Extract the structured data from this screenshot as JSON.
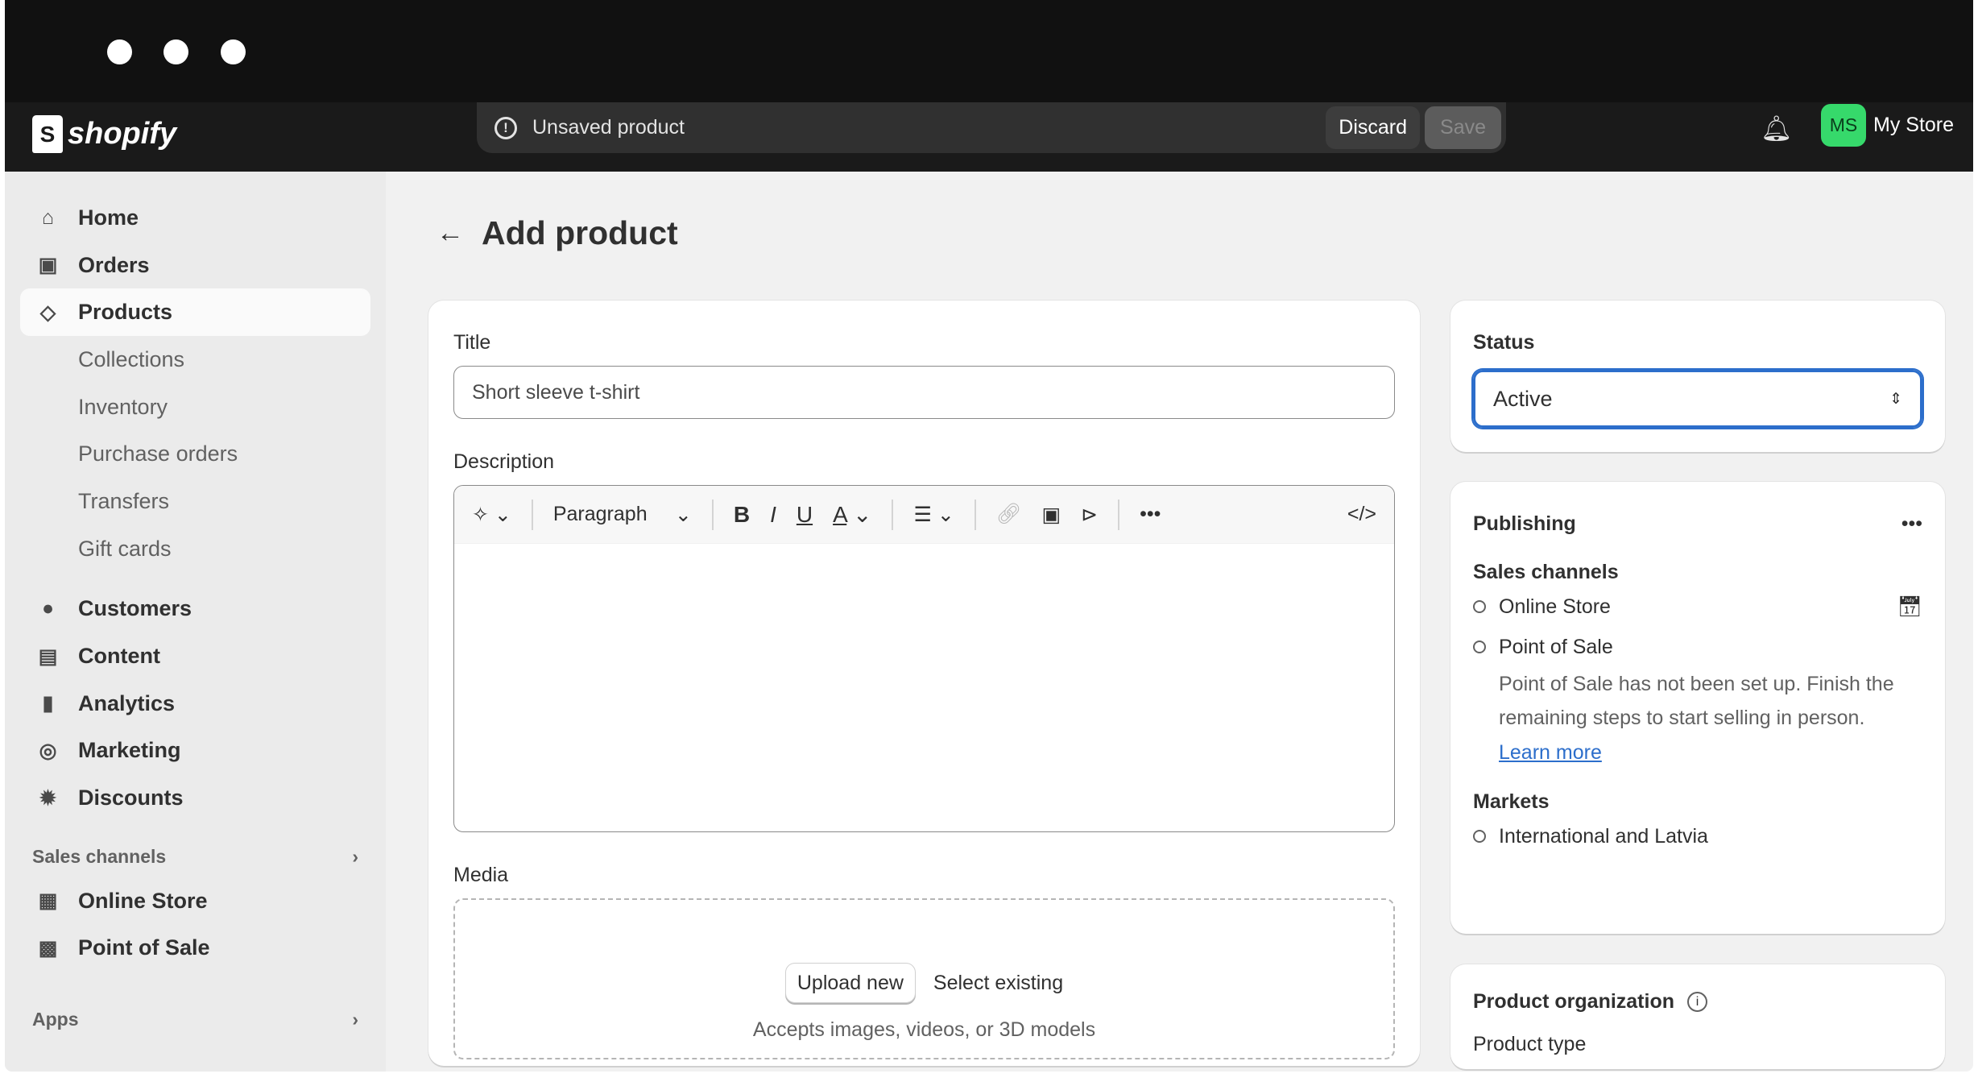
{
  "window": {
    "controls": [
      "close",
      "minimize",
      "maximize"
    ]
  },
  "topbar": {
    "logo": "shopify",
    "save_bar": {
      "message": "Unsaved product",
      "discard": "Discard",
      "save": "Save"
    },
    "store": {
      "initials": "MS",
      "name": "My Store"
    }
  },
  "sidebar": {
    "items": [
      {
        "label": "Home",
        "icon": "home-icon"
      },
      {
        "label": "Orders",
        "icon": "inbox-icon"
      },
      {
        "label": "Products",
        "icon": "tag-icon",
        "active": true
      }
    ],
    "product_sub": [
      "Collections",
      "Inventory",
      "Purchase orders",
      "Transfers",
      "Gift cards"
    ],
    "items2": [
      {
        "label": "Customers",
        "icon": "person-icon"
      },
      {
        "label": "Content",
        "icon": "image-icon"
      },
      {
        "label": "Analytics",
        "icon": "bar-chart-icon"
      },
      {
        "label": "Marketing",
        "icon": "target-icon"
      },
      {
        "label": "Discounts",
        "icon": "discount-icon"
      }
    ],
    "sales_channels": "Sales channels",
    "channels": [
      {
        "label": "Online Store",
        "icon": "store-icon"
      },
      {
        "label": "Point of Sale",
        "icon": "pos-icon"
      }
    ],
    "apps": "Apps"
  },
  "page": {
    "title": "Add product",
    "title_label": "Title",
    "title_value": "Short sleeve t-shirt",
    "description_label": "Description",
    "paragraph": "Paragraph",
    "media_label": "Media",
    "upload_new": "Upload new",
    "select_existing": "Select existing",
    "media_hint": "Accepts images, videos, or 3D models"
  },
  "status": {
    "label": "Status",
    "value": "Active",
    "accent": "#2c6ecb"
  },
  "publishing": {
    "title": "Publishing",
    "sales_channels": "Sales channels",
    "online_store": "Online Store",
    "point_of_sale": "Point of Sale",
    "pos_note": "Point of Sale has not been set up. Finish the remaining steps to start selling in person.",
    "learn_more": "Learn more",
    "markets": "Markets",
    "market": "International and Latvia"
  },
  "organization": {
    "title": "Product organization",
    "product_type": "Product type"
  }
}
